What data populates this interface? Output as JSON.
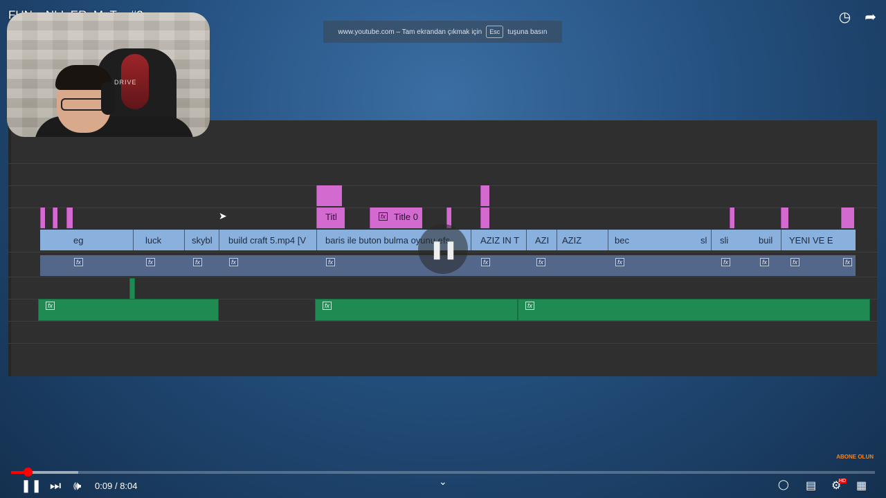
{
  "video": {
    "title": "FUN__NLI_ER_M_T__#2"
  },
  "top_icons": [
    "clock-icon",
    "share-icon"
  ],
  "toast": {
    "prefix": "www.youtube.com – Tam ekrandan çıkmak için",
    "key": "Esc",
    "suffix": "tuşuna basın"
  },
  "webcam": {
    "chair_brand": "DRIVE"
  },
  "timeline": {
    "title_clips": [
      "Titl",
      "Title 0"
    ],
    "video_clips": [
      "eg",
      "luck",
      "skybl",
      "build craft 5.mp4 [V",
      "baris ile buton bulma oyunu efs",
      "AZIZ IN T",
      "AZI",
      "AZIZ",
      "bec",
      "sl",
      "sli",
      "buil",
      "YENI VE E"
    ],
    "fx_label": "fx"
  },
  "player": {
    "current_time": "0:09",
    "separator": "/",
    "duration": "8:04",
    "progress_fraction": 0.019,
    "buffer_fraction": 0.078,
    "quality_badge": "HD"
  },
  "channel_watermark": "ABONE OLUN",
  "colors": {
    "progress": "#ff0000",
    "title_clip": "#d26ad0",
    "video_clip": "#8ab0dd",
    "audio_clip": "#53678a",
    "green_clip": "#1f8a52"
  }
}
